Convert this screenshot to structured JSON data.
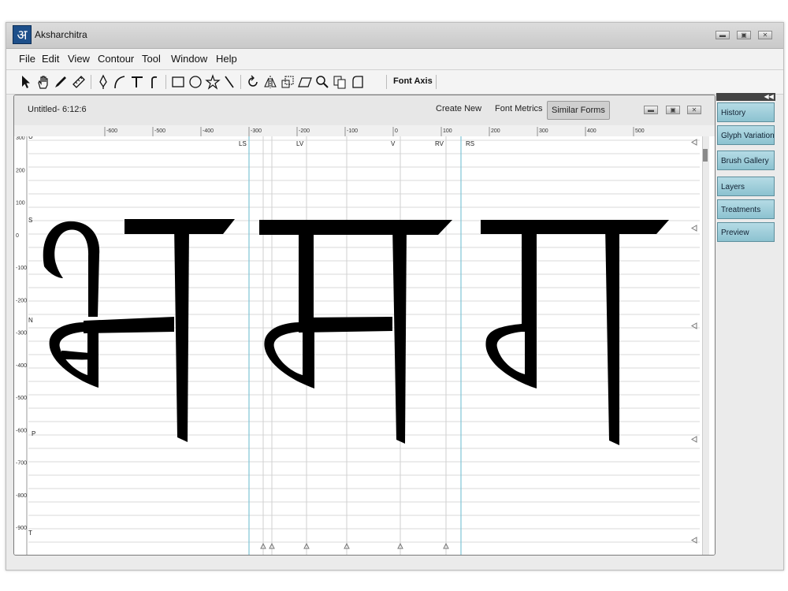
{
  "window": {
    "title": "Aksharchitra",
    "logo_glyph": "अ"
  },
  "menu": [
    "File",
    "Edit",
    "View",
    "Contour",
    "Tool",
    "Window",
    "Help"
  ],
  "toolbar": {
    "font_axis_label": "Font Axis",
    "icons": [
      "pointer-icon",
      "hand-icon",
      "pen-icon",
      "ruler-icon",
      "pen-nib-icon",
      "curve-icon",
      "t-stroke-icon",
      "f-stroke-icon",
      "rectangle-icon",
      "ellipse-icon",
      "star-icon",
      "line-icon",
      "rotate-icon",
      "mirror-icon",
      "scale-icon",
      "skew-icon",
      "zoom-icon",
      "copy-icon",
      "corner-icon"
    ]
  },
  "document": {
    "title": "Untitled- 6:12:6",
    "buttons": [
      "Create New",
      "Font Metrics",
      "Similar Forms"
    ],
    "active_button": "Similar Forms"
  },
  "ruler_x": [
    "-600",
    "-500",
    "-400",
    "-300",
    "-200",
    "-100",
    "0",
    "100",
    "200",
    "300",
    "400",
    "500"
  ],
  "ruler_y": [
    "300",
    "200",
    "100",
    "0",
    "-100",
    "-200",
    "-300",
    "-400",
    "-500",
    "-600",
    "-700",
    "-800",
    "-900"
  ],
  "row_labels": [
    "U",
    "S",
    "N",
    "P",
    "T"
  ],
  "guide_labels": [
    "LS",
    "LV",
    "V",
    "RV",
    "RS"
  ],
  "glyphs": [
    "भ",
    "म",
    "ग"
  ],
  "side_panel": [
    "History",
    "Glyph Variations",
    "Brush Gallery",
    "Layers",
    "Treatments",
    "Preview"
  ],
  "colors": {
    "guide": "#7fc4d6",
    "tab": "#9dcfdc",
    "ink": "#000000"
  }
}
